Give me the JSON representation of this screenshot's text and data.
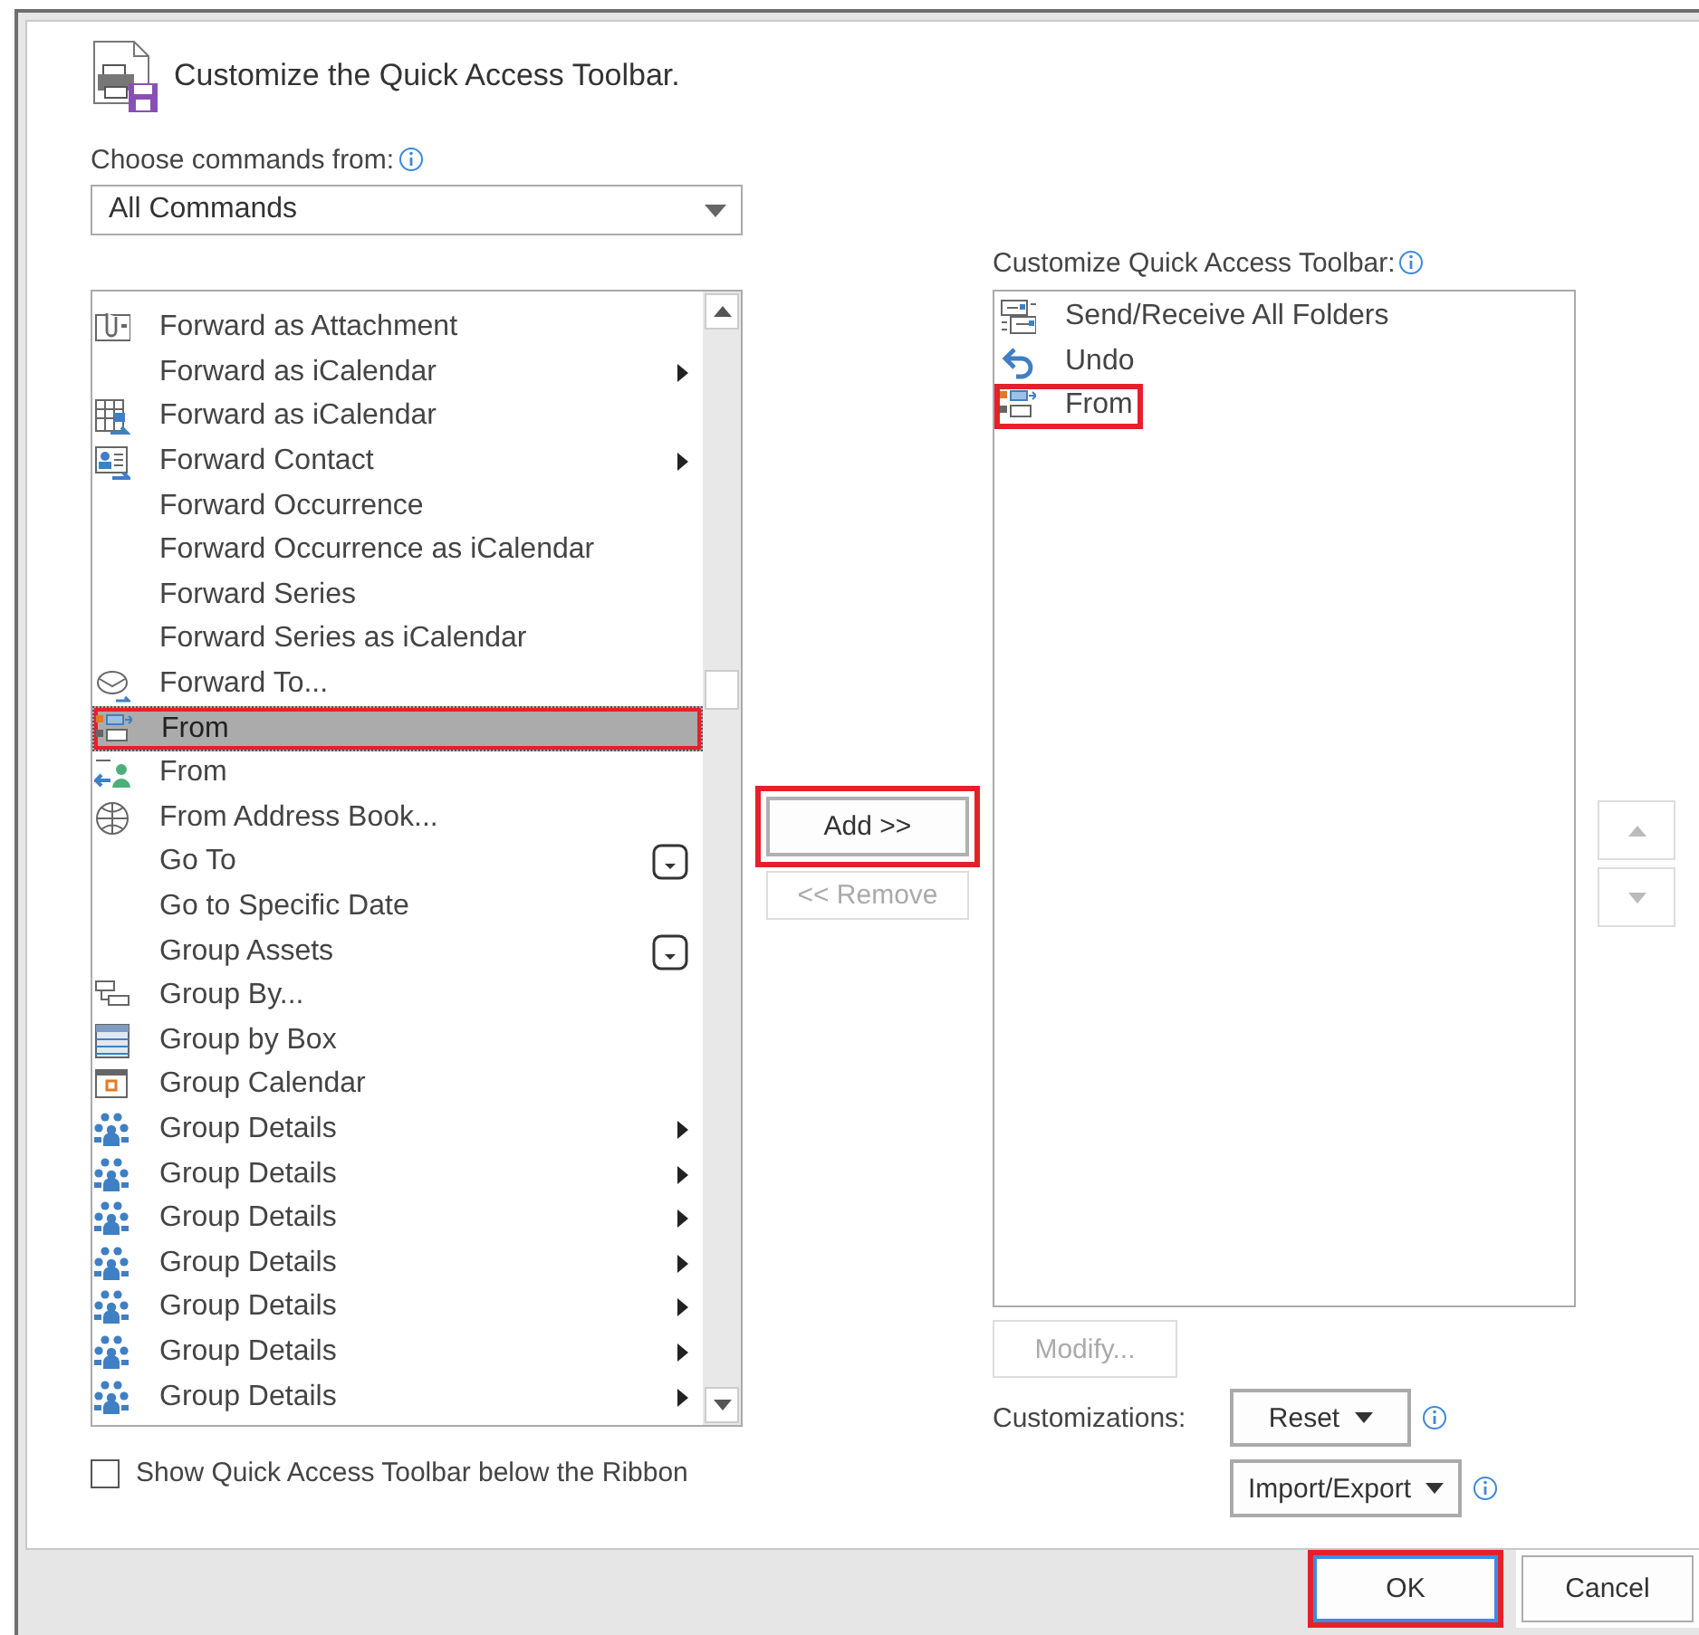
{
  "dialog": {
    "title": "Customize the Quick Access Toolbar."
  },
  "commands_source": {
    "label": "Choose commands from:",
    "value": "All Commands"
  },
  "commands": [
    {
      "label": "Forward as Attachment",
      "kind": "plain",
      "selected": false,
      "highlighted": false
    },
    {
      "label": "Forward as iCalendar",
      "kind": "submenu",
      "selected": false,
      "highlighted": false
    },
    {
      "label": "Forward as iCalendar",
      "kind": "plain",
      "selected": false,
      "highlighted": false
    },
    {
      "label": "Forward Contact",
      "kind": "submenu",
      "selected": false,
      "highlighted": false
    },
    {
      "label": "Forward Occurrence",
      "kind": "plain",
      "selected": false,
      "highlighted": false
    },
    {
      "label": "Forward Occurrence as iCalendar",
      "kind": "plain",
      "selected": false,
      "highlighted": false
    },
    {
      "label": "Forward Series",
      "kind": "plain",
      "selected": false,
      "highlighted": false
    },
    {
      "label": "Forward Series as iCalendar",
      "kind": "plain",
      "selected": false,
      "highlighted": false
    },
    {
      "label": "Forward To...",
      "kind": "plain",
      "selected": false,
      "highlighted": false
    },
    {
      "label": "From",
      "kind": "plain",
      "selected": true,
      "highlighted": true
    },
    {
      "label": "From",
      "kind": "plain",
      "selected": false,
      "highlighted": false
    },
    {
      "label": "From Address Book...",
      "kind": "plain",
      "selected": false,
      "highlighted": false
    },
    {
      "label": "Go To",
      "kind": "dropdown",
      "selected": false,
      "highlighted": false
    },
    {
      "label": "Go to Specific Date",
      "kind": "plain",
      "selected": false,
      "highlighted": false
    },
    {
      "label": "Group Assets",
      "kind": "dropdown",
      "selected": false,
      "highlighted": false
    },
    {
      "label": "Group By...",
      "kind": "plain",
      "selected": false,
      "highlighted": false
    },
    {
      "label": "Group by Box",
      "kind": "plain",
      "selected": false,
      "highlighted": false
    },
    {
      "label": "Group Calendar",
      "kind": "plain",
      "selected": false,
      "highlighted": false
    },
    {
      "label": "Group Details",
      "kind": "submenu",
      "selected": false,
      "highlighted": false
    },
    {
      "label": "Group Details",
      "kind": "submenu",
      "selected": false,
      "highlighted": false
    },
    {
      "label": "Group Details",
      "kind": "submenu",
      "selected": false,
      "highlighted": false
    },
    {
      "label": "Group Details",
      "kind": "submenu",
      "selected": false,
      "highlighted": false
    },
    {
      "label": "Group Details",
      "kind": "submenu",
      "selected": false,
      "highlighted": false
    },
    {
      "label": "Group Details",
      "kind": "submenu",
      "selected": false,
      "highlighted": false
    },
    {
      "label": "Group Details",
      "kind": "submenu",
      "selected": false,
      "highlighted": false
    }
  ],
  "transfer_buttons": [
    {
      "label": "Add >>",
      "disabled": false,
      "highlighted": true
    },
    {
      "label": "<< Remove",
      "disabled": true,
      "highlighted": false
    }
  ],
  "toolbar": {
    "label": "Customize Quick Access Toolbar:",
    "items": [
      {
        "label": "Send/Receive All Folders",
        "highlighted": false
      },
      {
        "label": "Undo",
        "highlighted": false
      },
      {
        "label": "From",
        "highlighted": true
      }
    ]
  },
  "move_buttons": [
    {
      "kind": "up",
      "disabled": true
    },
    {
      "kind": "down",
      "disabled": true
    }
  ],
  "modify_button": {
    "label": "Modify...",
    "disabled": true
  },
  "customizations": {
    "label": "Customizations:",
    "buttons": [
      {
        "label": "Reset"
      },
      {
        "label": "Import/Export"
      }
    ]
  },
  "show_below_ribbon": {
    "label": "Show Quick Access Toolbar below the Ribbon",
    "checked": false
  },
  "footer_buttons": [
    {
      "label": "OK",
      "default": true,
      "highlighted": true
    },
    {
      "label": "Cancel",
      "default": false,
      "highlighted": false
    }
  ]
}
